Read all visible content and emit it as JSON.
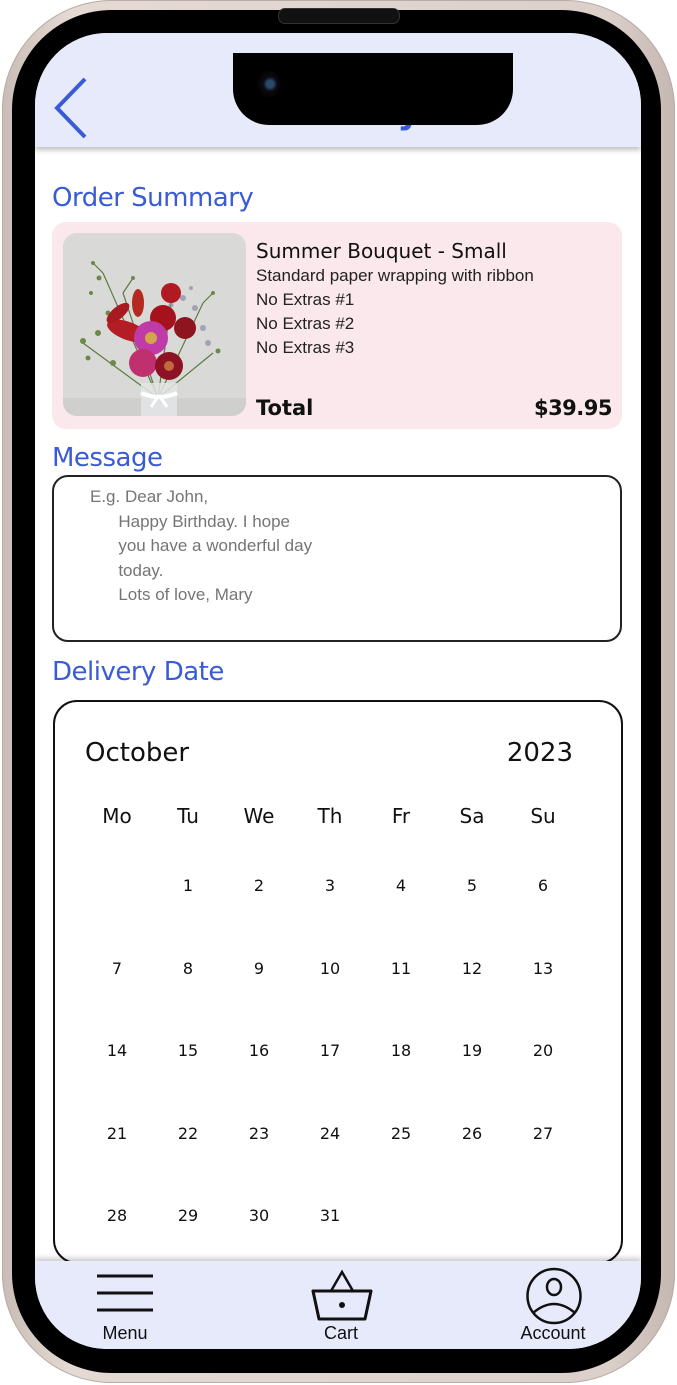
{
  "header": {
    "title": "Delivery",
    "back_icon": "chevron-left-icon"
  },
  "order_summary": {
    "heading": "Order Summary",
    "product_image": "flower-bouquet-photo",
    "product_name": "Summer Bouquet - Small",
    "details": [
      "Standard paper wrapping with ribbon",
      "No Extras #1",
      "No Extras #2",
      "No Extras #3"
    ],
    "total_label": "Total",
    "total_value": "$39.95"
  },
  "message": {
    "heading": "Message",
    "placeholder": "E.g. Dear John,\n      Happy Birthday. I hope\n      you have a wonderful day\n      today.\n      Lots of love, Mary",
    "value": ""
  },
  "delivery_date": {
    "heading": "Delivery Date",
    "month": "October",
    "year": "2023",
    "weekdays": [
      "Mo",
      "Tu",
      "We",
      "Th",
      "Fr",
      "Sa",
      "Su"
    ],
    "first_weekday_index": 1,
    "days": [
      "1",
      "2",
      "3",
      "4",
      "5",
      "6",
      "7",
      "8",
      "9",
      "10",
      "11",
      "12",
      "13",
      "14",
      "15",
      "16",
      "17",
      "18",
      "19",
      "20",
      "21",
      "22",
      "23",
      "24",
      "25",
      "26",
      "27",
      "28",
      "29",
      "30",
      "31"
    ]
  },
  "tabbar": {
    "items": [
      {
        "label": "Menu",
        "icon": "hamburger-menu-icon"
      },
      {
        "label": "Cart",
        "icon": "basket-icon"
      },
      {
        "label": "Account",
        "icon": "user-circle-icon"
      }
    ]
  },
  "colors": {
    "accent": "#3a5bd6",
    "header_bg": "#e6eafb",
    "card_bg": "#fbe8ec"
  }
}
